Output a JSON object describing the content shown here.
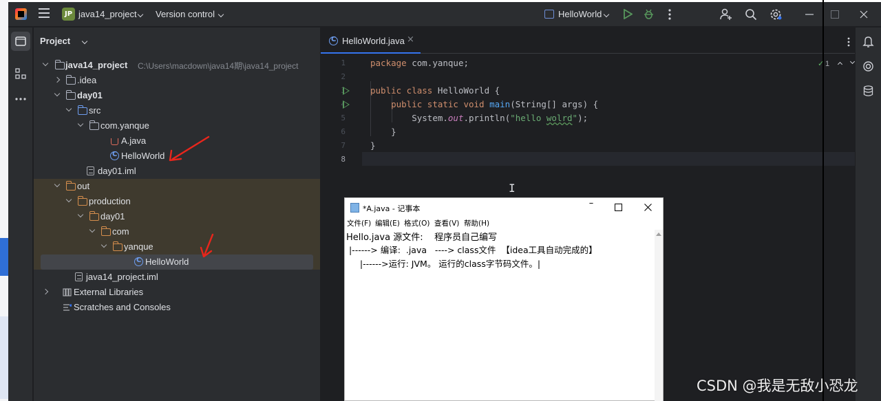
{
  "colors": {
    "ide_bg": "#1e1f22",
    "panel_bg": "#2b2d30",
    "accent": "#3574f0",
    "excluded_bg": "#3f3a2e",
    "arrow_red": "#e8261c"
  },
  "titlebar": {
    "badge": "JP",
    "project": "java14_project",
    "vcs": "Version control",
    "run_config": "HelloWorld",
    "icons": [
      "intellij-logo-icon",
      "hamburger-icon",
      "run-icon",
      "debug-icon",
      "more-icon",
      "add-user-icon",
      "search-icon",
      "settings-icon",
      "minimize-icon",
      "maximize-icon",
      "close-icon"
    ]
  },
  "project_panel": {
    "header": "Project",
    "tree": [
      {
        "label": "java14_project",
        "path": "C:\\Users\\macdown\\java14期\\java14_project",
        "bold": true
      },
      {
        "label": ".idea"
      },
      {
        "label": "day01",
        "bold": true
      },
      {
        "label": "src"
      },
      {
        "label": "com.yanque"
      },
      {
        "label": "A.java"
      },
      {
        "label": "HelloWorld"
      },
      {
        "label": "day01.iml"
      },
      {
        "label": "out"
      },
      {
        "label": "production"
      },
      {
        "label": "day01"
      },
      {
        "label": "com"
      },
      {
        "label": "yanque"
      },
      {
        "label": "HelloWorld"
      },
      {
        "label": "java14_project.iml"
      },
      {
        "label": "External Libraries"
      },
      {
        "label": "Scratches and Consoles"
      }
    ]
  },
  "editor": {
    "tab": "HelloWorld.java",
    "inspection_count": "1",
    "line_numbers": [
      "1",
      "2",
      "3",
      "4",
      "5",
      "6",
      "7",
      "8"
    ],
    "code": {
      "l1_kw": "package",
      "l1_rest": " com.yanque;",
      "l3_kw": "public class",
      "l3_rest": " HelloWorld {",
      "l4_kw": "public static void",
      "l4_fn": "main",
      "l4_rest": "(String[] args) {",
      "l5_a": "System.",
      "l5_out": "out",
      "l5_b": ".println(",
      "l5_str1": "\"hello ",
      "l5_str2": "wolrd",
      "l5_str3": "\"",
      "l5_c": ");",
      "l6": "}",
      "l7": "}"
    }
  },
  "notepad": {
    "title": "*A.java - 记事本",
    "menu": [
      "文件(F)",
      "编辑(E)",
      "格式(O)",
      "查看(V)",
      "帮助(H)"
    ],
    "lines": [
      "Hello.java 源文件:    程序员自己编写",
      " |------> 编译:  .java   ----> class文件  【idea工具自动完成的】",
      "     |------>运行: JVM。 运行的class字节码文件。|"
    ]
  },
  "watermark": "CSDN @我是无敌小恐龙"
}
